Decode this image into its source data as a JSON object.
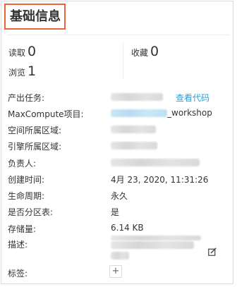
{
  "section": {
    "title": "基础信息"
  },
  "stats": {
    "read": {
      "label": "读取",
      "value": "0"
    },
    "favorite": {
      "label": "收藏",
      "value": "0"
    },
    "browse": {
      "label": "浏览",
      "value": "1"
    }
  },
  "info": {
    "output_task": {
      "label": "产出任务:",
      "link": "查看代码"
    },
    "maxcompute_project": {
      "label": "MaxCompute项目:",
      "value_suffix": "_workshop"
    },
    "space_region": {
      "label": "空间所属区域:"
    },
    "engine_region": {
      "label": "引擎所属区域:"
    },
    "owner": {
      "label": "负责人:"
    },
    "created_time": {
      "label": "创建时间:",
      "value": "4月 23, 2020, 11:31:26"
    },
    "lifecycle": {
      "label": "生命周期:",
      "value": "永久"
    },
    "partitioned": {
      "label": "是否分区表:",
      "value": "是"
    },
    "storage": {
      "label": "存储量:",
      "value": "6.14 KB"
    },
    "description": {
      "label": "描述:"
    },
    "tags": {
      "label": "标签:",
      "add_label": "+"
    }
  },
  "colors": {
    "accent_border": "#e8653a",
    "link": "#2a9fd6"
  },
  "icons": {
    "edit": "edit-icon",
    "add": "plus-icon"
  }
}
